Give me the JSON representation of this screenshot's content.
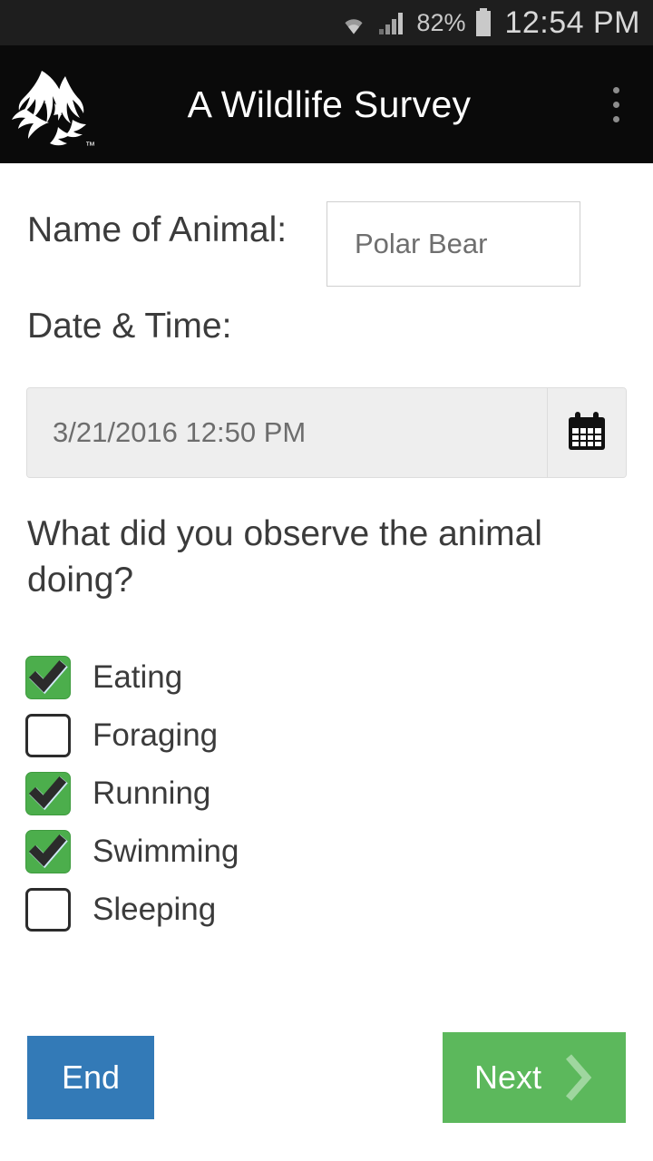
{
  "status_bar": {
    "wifi_icon": "wifi-icon",
    "signal_icon": "cellular-signal-icon",
    "battery_percent": "82%",
    "battery_icon": "battery-icon",
    "clock": "12:54 PM"
  },
  "app_bar": {
    "logo_icon": "app-logo-icon",
    "title": "A Wildlife Survey",
    "overflow_icon": "overflow-menu-icon"
  },
  "form": {
    "name_label": "Name of Animal:",
    "name_value": "Polar Bear",
    "name_placeholder": "Polar Bear",
    "datetime_label": "Date & Time:",
    "datetime_value": "3/21/2016 12:50 PM",
    "datetime_placeholder": "3/21/2016 12:50 PM",
    "calendar_icon": "calendar-icon",
    "question": "What did you observe the animal doing?",
    "options": [
      {
        "label": "Eating",
        "checked": true
      },
      {
        "label": "Foraging",
        "checked": false
      },
      {
        "label": "Running",
        "checked": true
      },
      {
        "label": "Swimming",
        "checked": true
      },
      {
        "label": "Sleeping",
        "checked": false
      }
    ]
  },
  "actions": {
    "end_label": "End",
    "next_label": "Next",
    "next_icon": "chevron-right-icon"
  },
  "colors": {
    "status_bar_bg": "#1e1e1e",
    "app_bar_bg": "#0a0a0a",
    "checkbox_green": "#4cae4c",
    "end_blue": "#337ab7",
    "next_green": "#5cb85c",
    "text_dark": "#3b3b3b",
    "field_gray": "#eeeeee"
  }
}
